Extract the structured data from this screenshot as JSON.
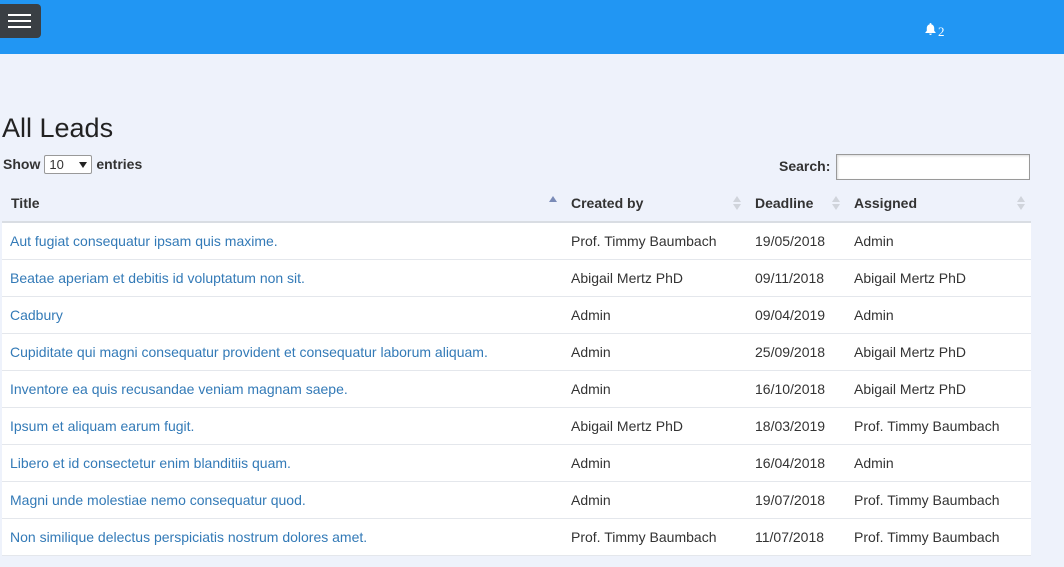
{
  "header": {
    "menu_icon": "hamburger-icon",
    "notification_icon": "bell-icon",
    "notification_count": "2",
    "colors": {
      "bar": "#2196f3",
      "menu_button": "#3a3f44"
    }
  },
  "page": {
    "title": "All Leads"
  },
  "controls": {
    "show_label": "Show",
    "entries_value": "10",
    "entries_label": "entries",
    "search_label": "Search:",
    "search_value": ""
  },
  "table": {
    "columns": [
      {
        "label": "Title",
        "sort": "asc"
      },
      {
        "label": "Created by",
        "sort": "none"
      },
      {
        "label": "Deadline",
        "sort": "none"
      },
      {
        "label": "Assigned",
        "sort": "none"
      }
    ],
    "rows": [
      {
        "title": "Aut fugiat consequatur ipsam quis maxime.",
        "created_by": "Prof. Timmy Baumbach",
        "deadline": "19/05/2018",
        "assigned": "Admin"
      },
      {
        "title": "Beatae aperiam et debitis id voluptatum non sit.",
        "created_by": "Abigail Mertz PhD",
        "deadline": "09/11/2018",
        "assigned": "Abigail Mertz PhD"
      },
      {
        "title": "Cadbury",
        "created_by": "Admin",
        "deadline": "09/04/2019",
        "assigned": "Admin"
      },
      {
        "title": "Cupiditate qui magni consequatur provident et consequatur laborum aliquam.",
        "created_by": "Admin",
        "deadline": "25/09/2018",
        "assigned": "Abigail Mertz PhD"
      },
      {
        "title": "Inventore ea quis recusandae veniam magnam saepe.",
        "created_by": "Admin",
        "deadline": "16/10/2018",
        "assigned": "Abigail Mertz PhD"
      },
      {
        "title": "Ipsum et aliquam earum fugit.",
        "created_by": "Abigail Mertz PhD",
        "deadline": "18/03/2019",
        "assigned": "Prof. Timmy Baumbach"
      },
      {
        "title": "Libero et id consectetur enim blanditiis quam.",
        "created_by": "Admin",
        "deadline": "16/04/2018",
        "assigned": "Admin"
      },
      {
        "title": "Magni unde molestiae nemo consequatur quod.",
        "created_by": "Admin",
        "deadline": "19/07/2018",
        "assigned": "Prof. Timmy Baumbach"
      },
      {
        "title": "Non similique delectus perspiciatis nostrum dolores amet.",
        "created_by": "Prof. Timmy Baumbach",
        "deadline": "11/07/2018",
        "assigned": "Prof. Timmy Baumbach"
      }
    ]
  }
}
